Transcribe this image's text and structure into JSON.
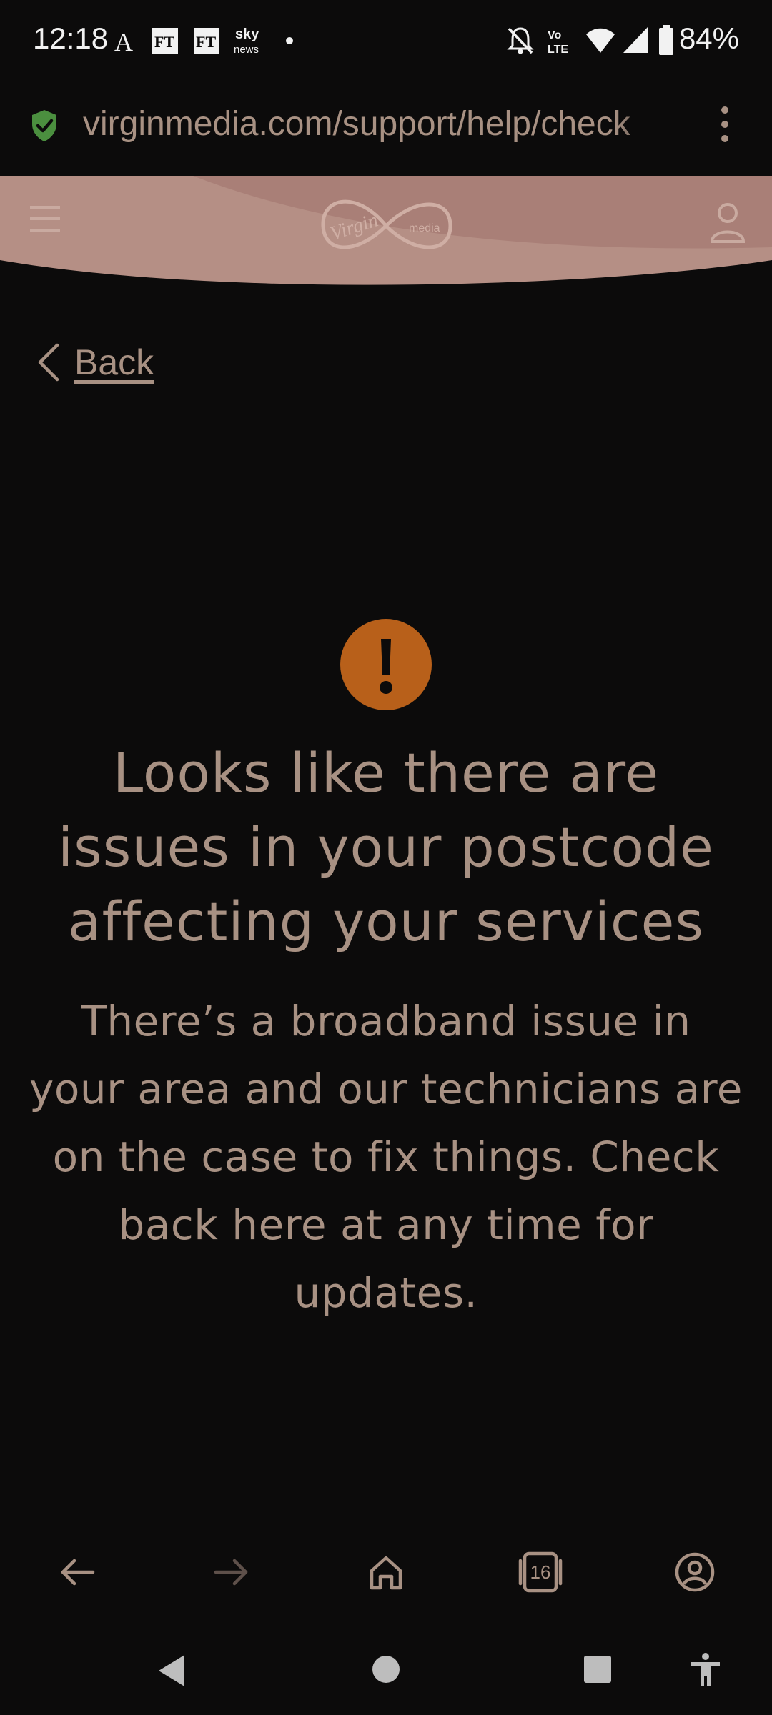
{
  "status_bar": {
    "time": "12:18",
    "battery_percent": "84%",
    "notification_icons": [
      "app-a-icon",
      "ft-icon",
      "ft-icon",
      "sky-news-icon",
      "dot-icon"
    ],
    "system_icons": [
      "mute-icon",
      "volte-icon",
      "wifi-icon",
      "signal-icon",
      "battery-icon"
    ]
  },
  "browser": {
    "url": "virginmedia.com/support/help/check",
    "tab_count": "16"
  },
  "site": {
    "logo_text": "Virgin media"
  },
  "content": {
    "back_label": "Back",
    "heading": "Looks like there are issues in your postcode affecting your services",
    "message": "There’s a broadband issue in your area and our technicians are on the case to fix things. Check back here at any time for updates."
  },
  "colors": {
    "background": "#0c0b0b",
    "text": "#a89183",
    "alert": "#b8601a",
    "header": "#b08880"
  }
}
